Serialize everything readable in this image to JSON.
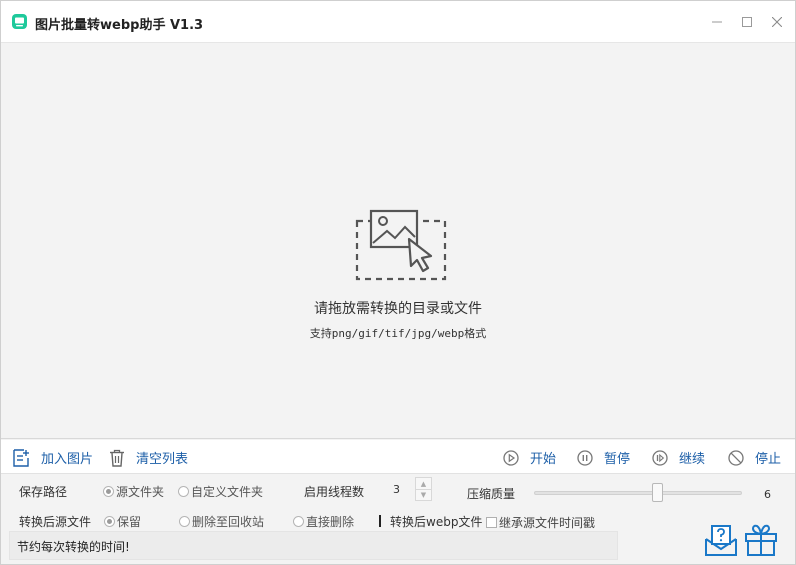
{
  "window": {
    "title": "图片批量转webp助手 V1.3",
    "accent": "#1ec99b",
    "link_color": "#1d5fa8"
  },
  "droparea": {
    "hint": "请拖放需转换的目录或文件",
    "formats": "支持png/gif/tif/jpg/webp格式"
  },
  "toolbar": {
    "add_label": "加入图片",
    "clear_label": "清空列表",
    "start_label": "开始",
    "pause_label": "暂停",
    "resume_label": "继续",
    "stop_label": "停止"
  },
  "settings": {
    "save_path_label": "保存路径",
    "save_path_options": [
      "源文件夹",
      "自定义文件夹"
    ],
    "save_path_selected": "源文件夹",
    "threads_label": "启用线程数",
    "threads_value": "3",
    "quality_label": "压缩质量",
    "quality_value": "6",
    "source_after_label": "转换后源文件",
    "source_after_options": [
      "保留",
      "删除至回收站",
      "直接删除"
    ],
    "source_after_selected": "保留",
    "output_label": "转换后webp文件",
    "inherit_time_label": "继承源文件时间戳",
    "inherit_time_checked": false
  },
  "status": {
    "message": "节约每次转换的时间!"
  },
  "icons": {
    "app": "app-icon",
    "minimize": "minimize-icon",
    "maximize": "maximize-icon",
    "close": "close-icon",
    "drop": "image-drop-icon",
    "add": "add-image-icon",
    "clear": "trash-icon",
    "start": "play-icon",
    "pause": "pause-icon",
    "resume": "resume-icon",
    "stop": "stop-icon",
    "help": "help-icon",
    "gift": "gift-icon"
  }
}
